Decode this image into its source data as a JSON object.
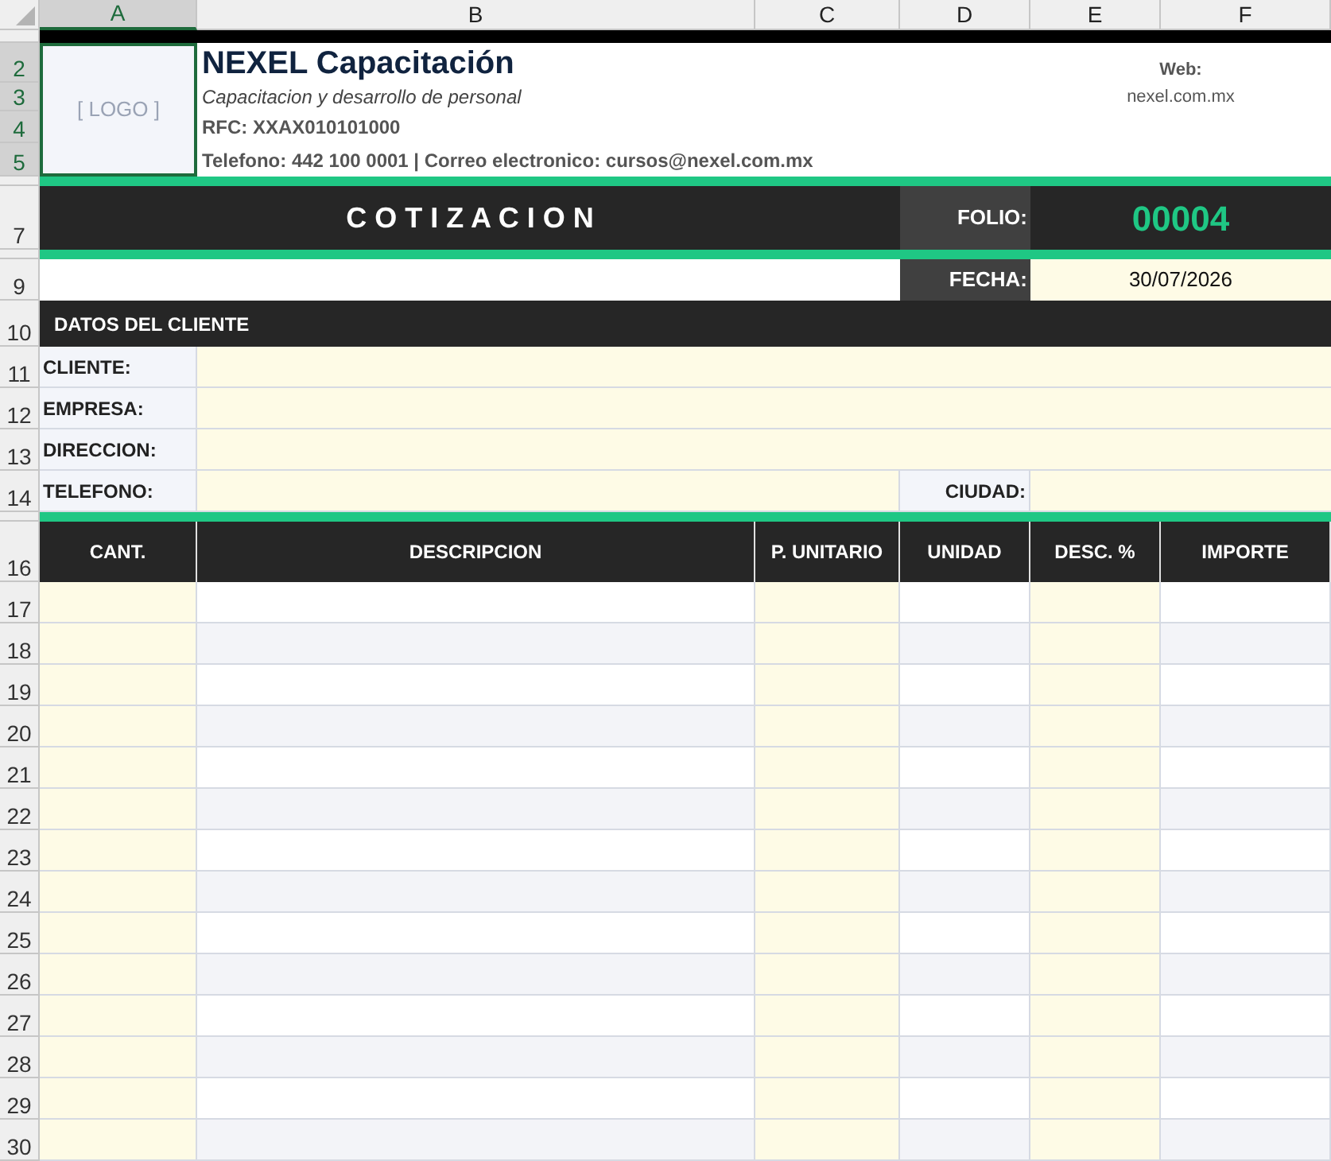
{
  "column_headers": [
    {
      "label": "A",
      "selected": true
    },
    {
      "label": "B",
      "selected": false
    },
    {
      "label": "C",
      "selected": false
    },
    {
      "label": "D",
      "selected": false
    },
    {
      "label": "E",
      "selected": false
    },
    {
      "label": "F",
      "selected": false
    }
  ],
  "row_headers": [
    {
      "selected": false
    },
    {
      "label": "2",
      "selected": true
    },
    {
      "label": "3",
      "selected": true
    },
    {
      "label": "4",
      "selected": true
    },
    {
      "label": "5",
      "selected": true
    },
    {
      "selected": false
    },
    {
      "label": "7",
      "selected": false
    },
    {
      "selected": false
    },
    {
      "label": "9",
      "selected": false
    },
    {
      "label": "10",
      "selected": false
    },
    {
      "label": "11",
      "selected": false
    },
    {
      "label": "12",
      "selected": false
    },
    {
      "label": "13",
      "selected": false
    },
    {
      "label": "14",
      "selected": false
    },
    {
      "selected": false
    },
    {
      "label": "16",
      "selected": false
    },
    {
      "label": "17",
      "selected": false
    },
    {
      "label": "18",
      "selected": false
    },
    {
      "label": "19",
      "selected": false
    },
    {
      "label": "20",
      "selected": false
    },
    {
      "label": "21",
      "selected": false
    },
    {
      "label": "22",
      "selected": false
    },
    {
      "label": "23",
      "selected": false
    },
    {
      "label": "24",
      "selected": false
    },
    {
      "label": "25",
      "selected": false
    },
    {
      "label": "26",
      "selected": false
    },
    {
      "label": "27",
      "selected": false
    },
    {
      "label": "28",
      "selected": false
    },
    {
      "label": "29",
      "selected": false
    },
    {
      "label": "30",
      "selected": false
    }
  ],
  "company": {
    "logo_placeholder": "[ LOGO ]",
    "name": "NEXEL Capacitación",
    "tagline": "Capacitacion y desarrollo de personal",
    "rfc": "RFC: XXAX010101000",
    "contact": "Telefono: 442 100 0001 | Correo electronico: cursos@nexel.com.mx",
    "web_label": "Web:",
    "web": "nexel.com.mx"
  },
  "title": "C O T I Z A C I O N",
  "folio": {
    "label": "FOLIO:",
    "value": "00004"
  },
  "fecha": {
    "label": "FECHA:",
    "value": "30/07/2026"
  },
  "client": {
    "title": "DATOS DEL CLIENTE",
    "fields": [
      {
        "label": "CLIENTE:"
      },
      {
        "label": "EMPRESA:"
      },
      {
        "label": "DIRECCION:"
      },
      {
        "label": "TELEFONO:"
      }
    ],
    "city_label": "CIUDAD:"
  },
  "items_table": {
    "columns": [
      "CANT.",
      "DESCRIPCION",
      "P. UNITARIO",
      "UNIDAD",
      "DESC. %",
      "IMPORTE"
    ]
  }
}
